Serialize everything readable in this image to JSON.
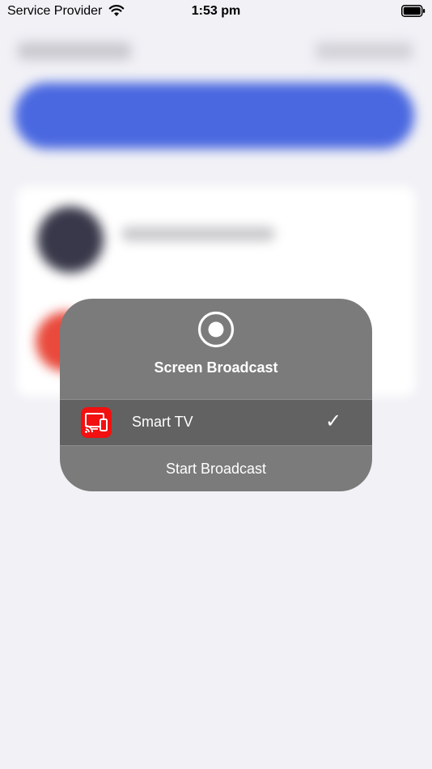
{
  "status_bar": {
    "carrier": "Service Provider",
    "time": "1:53 pm"
  },
  "broadcast_sheet": {
    "title": "Screen Broadcast",
    "options": [
      {
        "label": "Smart TV",
        "icon": "cast-to-tv-icon",
        "selected": true
      }
    ],
    "start_label": "Start Broadcast"
  },
  "colors": {
    "app_icon": "#f21010",
    "sheet_background": "#7b7b7b",
    "selected_row": "#626262",
    "page_background": "#f1f1f6"
  }
}
